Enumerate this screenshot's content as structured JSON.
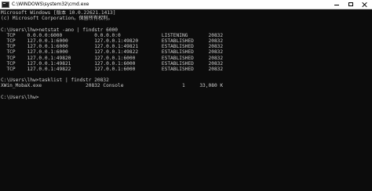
{
  "window": {
    "title": "C:\\WINDOWS\\system32\\cmd.exe"
  },
  "console": {
    "lines": [
      "Microsoft Windows [版本 10.0.22621.1413]",
      "(c) Microsoft Corporation。保留所有权利。",
      "",
      "C:\\Users\\lhw>netstat -ano | findstr 6000",
      "  TCP    0.0.0.0:6000           0.0.0.0:0              LISTENING       20832",
      "  TCP    127.0.0.1:6000         127.0.0.1:49820        ESTABLISHED     20832",
      "  TCP    127.0.0.1:6000         127.0.0.1:49821        ESTABLISHED     20832",
      "  TCP    127.0.0.1:6000         127.0.0.1:49822        ESTABLISHED     20832",
      "  TCP    127.0.0.1:49820        127.0.0.1:6000         ESTABLISHED     20832",
      "  TCP    127.0.0.1:49821        127.0.0.1:6000         ESTABLISHED     20832",
      "  TCP    127.0.0.1:49822        127.0.0.1:6000         ESTABLISHED     20832",
      "",
      "C:\\Users\\lhw>tasklist | findstr 20832",
      "XWin_MobaX.exe               20832 Console                    1     33,080 K",
      "",
      "C:\\Users\\lhw>"
    ]
  }
}
